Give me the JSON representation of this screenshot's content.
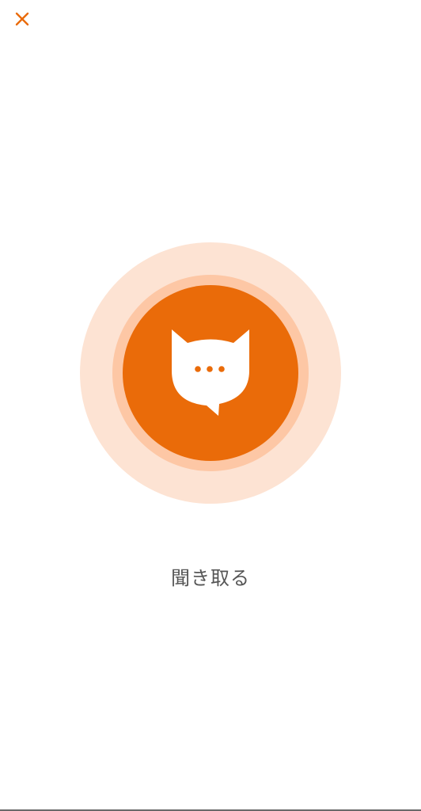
{
  "colors": {
    "accent": "#EA6B09",
    "ring_inner": "#FDC7A5",
    "ring_outer": "#FDE3D3",
    "label_text": "#555555",
    "background": "#FFFFFF"
  },
  "header": {
    "close_icon": "close-icon"
  },
  "main": {
    "button_icon": "cat-chat-icon",
    "label": "聞き取る"
  }
}
